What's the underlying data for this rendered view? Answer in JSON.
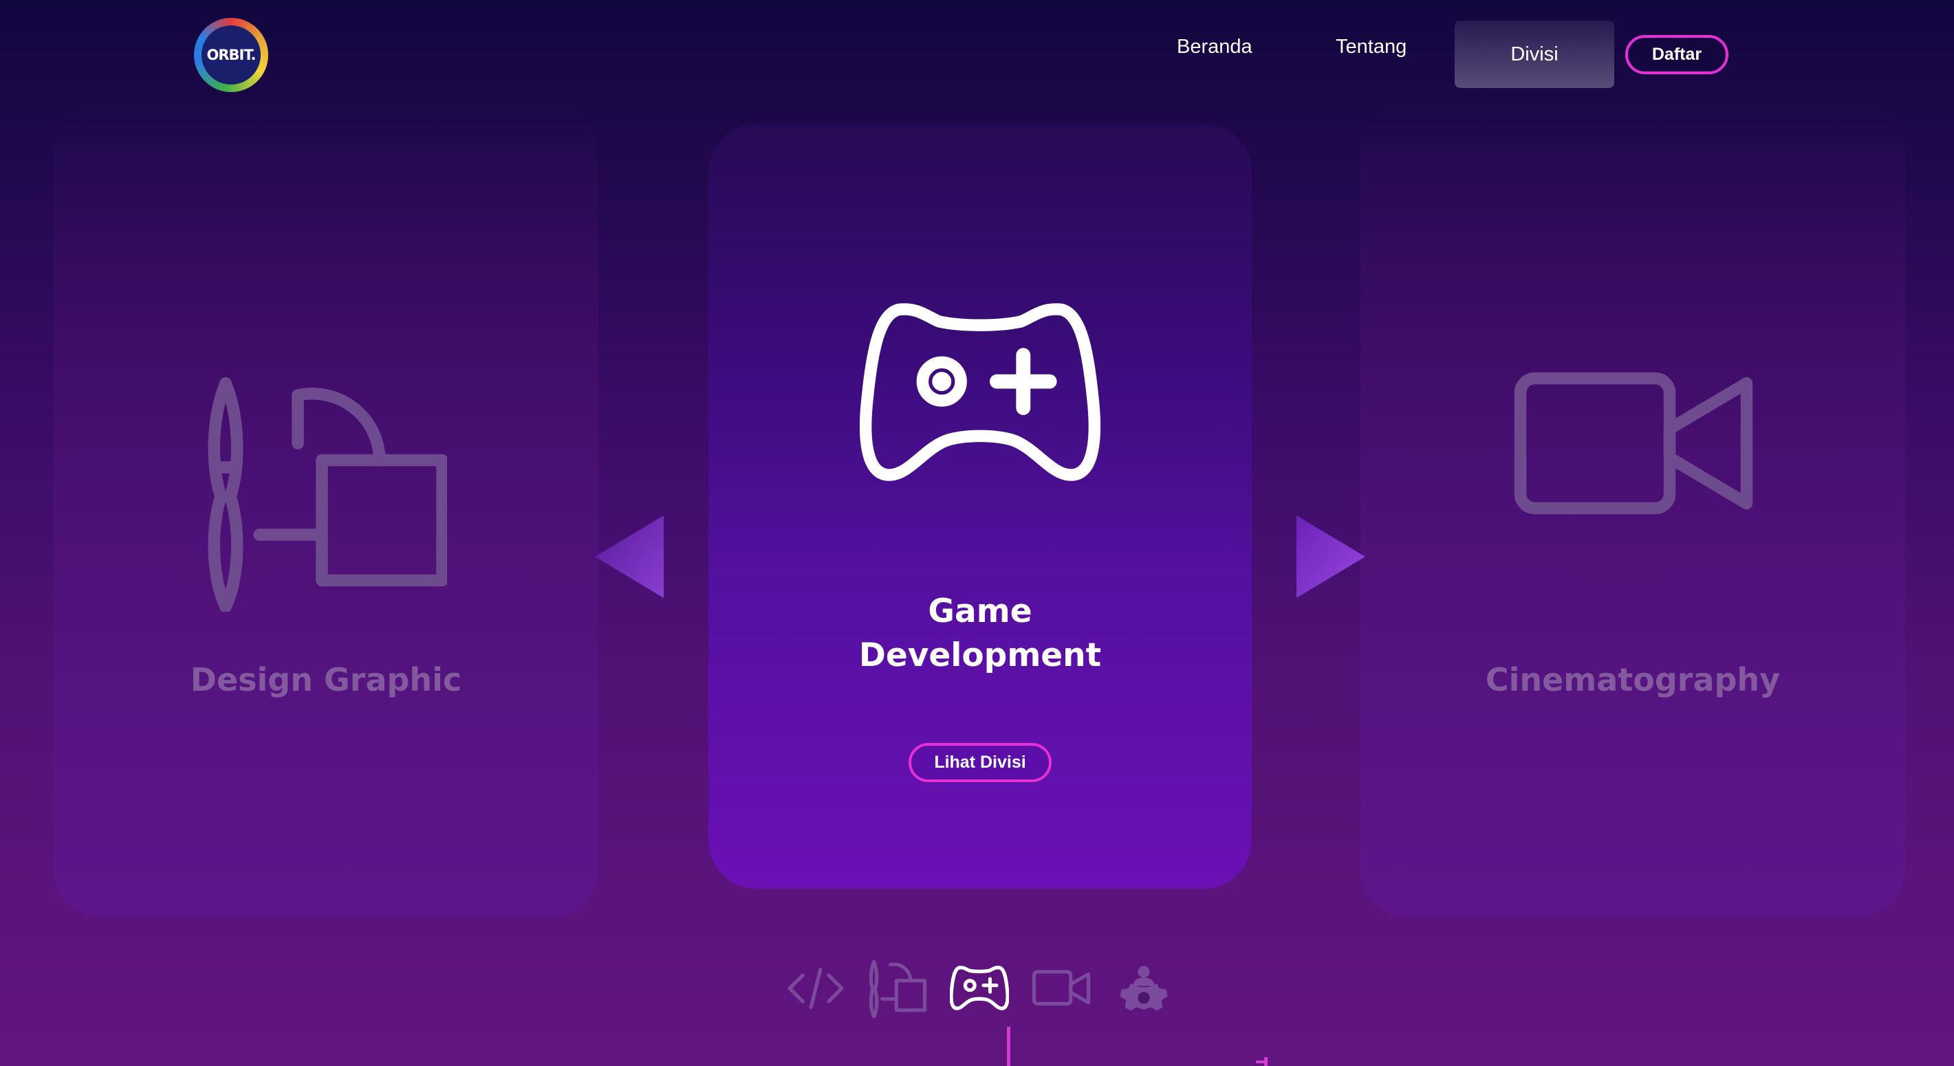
{
  "nav": {
    "logo_text": "ORBIT.",
    "links": [
      "Beranda",
      "Tentang",
      "Divisi"
    ],
    "cta": "Daftar"
  },
  "carousel": {
    "left": {
      "title": "Design Graphic",
      "icon": "design-tools-icon"
    },
    "center": {
      "title_line1": "Game",
      "title_line2": "Development",
      "icon": "gamepad-icon",
      "button": "Lihat Divisi"
    },
    "right": {
      "title": "Cinematography",
      "icon": "video-camera-icon"
    },
    "prev_icon": "chevron-left-triangle-icon",
    "next_icon": "chevron-right-triangle-icon"
  },
  "tabs": [
    {
      "icon": "code-icon",
      "active": false
    },
    {
      "icon": "design-tools-icon",
      "active": false
    },
    {
      "icon": "gamepad-icon",
      "active": true
    },
    {
      "icon": "video-camera-icon",
      "active": false
    },
    {
      "icon": "gear-person-icon",
      "active": false
    }
  ],
  "colors": {
    "accent": "#e62fd4",
    "card_center": "#6a10b5",
    "inactive_icon": "#7a4a9c"
  }
}
